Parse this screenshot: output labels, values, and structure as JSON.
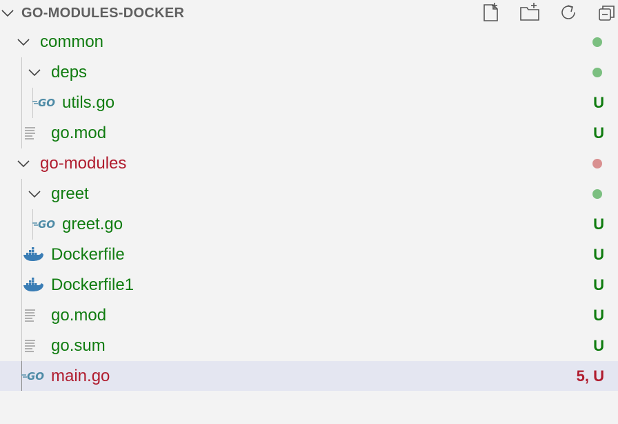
{
  "explorer": {
    "title": "GO-MODULES-DOCKER",
    "actions": [
      {
        "name": "new-file-icon"
      },
      {
        "name": "new-folder-icon"
      },
      {
        "name": "refresh-icon"
      },
      {
        "name": "collapse-all-icon"
      }
    ]
  },
  "colors": {
    "untracked": "#107c10",
    "modified": "#b01c2e",
    "dot_green": "#7bbf80",
    "dot_red": "#d99090",
    "go_icon": "#4e8ba6",
    "docker_icon": "#3a7db5",
    "selected_bg": "#e4e6f1"
  },
  "tree": [
    {
      "label": "common",
      "type": "folder",
      "expanded": true,
      "depth": 0,
      "icon": "chevron-down-icon",
      "decoration": "dot",
      "color": "green"
    },
    {
      "label": "deps",
      "type": "folder",
      "expanded": true,
      "depth": 1,
      "icon": "chevron-down-icon",
      "decoration": "dot",
      "color": "green"
    },
    {
      "label": "utils.go",
      "type": "file",
      "depth": 2,
      "icon": "go-file-icon",
      "status": "U",
      "color": "green"
    },
    {
      "label": "go.mod",
      "type": "file",
      "depth": 1,
      "icon": "text-file-icon",
      "status": "U",
      "color": "green"
    },
    {
      "label": "go-modules",
      "type": "folder",
      "expanded": true,
      "depth": 0,
      "icon": "chevron-down-icon",
      "decoration": "dot",
      "color": "red"
    },
    {
      "label": "greet",
      "type": "folder",
      "expanded": true,
      "depth": 1,
      "icon": "chevron-down-icon",
      "decoration": "dot",
      "color": "green"
    },
    {
      "label": "greet.go",
      "type": "file",
      "depth": 2,
      "icon": "go-file-icon",
      "status": "U",
      "color": "green"
    },
    {
      "label": "Dockerfile",
      "type": "file",
      "depth": 1,
      "icon": "docker-file-icon",
      "status": "U",
      "color": "green"
    },
    {
      "label": "Dockerfile1",
      "type": "file",
      "depth": 1,
      "icon": "docker-file-icon",
      "status": "U",
      "color": "green"
    },
    {
      "label": "go.mod",
      "type": "file",
      "depth": 1,
      "icon": "text-file-icon",
      "status": "U",
      "color": "green"
    },
    {
      "label": "go.sum",
      "type": "file",
      "depth": 1,
      "icon": "text-file-icon",
      "status": "U",
      "color": "green"
    },
    {
      "label": "main.go",
      "type": "file",
      "depth": 1,
      "icon": "go-file-icon",
      "status": "5, U",
      "color": "red",
      "selected": true
    }
  ]
}
